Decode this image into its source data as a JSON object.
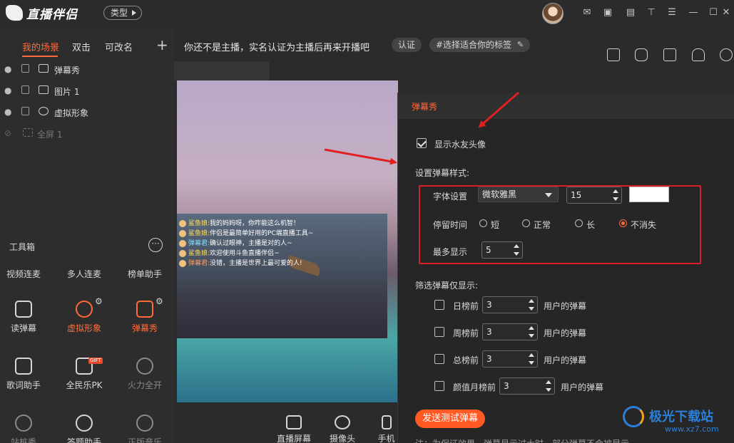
{
  "app": {
    "name": "直播伴侣",
    "type_button": "类型"
  },
  "titlebar_icons": [
    "mail-icon",
    "video-icon",
    "save-icon",
    "shirt-icon",
    "menu-icon",
    "minimize-icon",
    "maximize-icon",
    "close-icon"
  ],
  "scenes": {
    "tabs": [
      {
        "label": "我的场景",
        "active": true
      },
      {
        "label": "双击"
      },
      {
        "label": "可改名"
      }
    ],
    "add_label": "+",
    "layers": [
      {
        "label": "弹幕秀",
        "icon": "danmaku-icon",
        "visible": true
      },
      {
        "label": "图片 1",
        "icon": "image-icon",
        "visible": true
      },
      {
        "label": "虚拟形象",
        "icon": "avatar-icon",
        "visible": true
      },
      {
        "label": "全屏 1",
        "icon": "fullscreen-icon",
        "visible": false
      }
    ]
  },
  "toolbox": {
    "title": "工具箱",
    "more": "···",
    "tools": [
      {
        "label": "视频连麦"
      },
      {
        "label": "多人连麦"
      },
      {
        "label": "榜单助手"
      },
      {
        "label": "读弹幕"
      },
      {
        "label": "虚拟形象",
        "active": true
      },
      {
        "label": "弹幕秀",
        "active": true
      },
      {
        "label": "歌词助手"
      },
      {
        "label": "全民乐PK",
        "badge": "GIFT"
      },
      {
        "label": "火力全开",
        "disabled": true
      },
      {
        "label": "站桩秀",
        "disabled": true
      },
      {
        "label": "答题助手"
      },
      {
        "label": "正版音乐",
        "disabled": true
      }
    ]
  },
  "notice": {
    "text": "你还不是主播，实名认证为主播后再来开播吧",
    "verify_button": "认证",
    "tag_button": "#选择适合你的标签"
  },
  "preview_chat": [
    {
      "name": "鲨鱼娘:",
      "text": "我的妈妈呀，你咋能这么机智！",
      "color": "#ffdd55"
    },
    {
      "name": "鲨鱼娘:",
      "text": "伴侣是最简单好用的PC端直播工具~",
      "color": "#ffdd55"
    },
    {
      "name": "弹幕君:",
      "text": "确认过眼神，主播是对的人~",
      "color": "#7fe3ff"
    },
    {
      "name": "鲨鱼娘:",
      "text": "欢迎使用斗鱼直播伴侣~",
      "color": "#ffdd55"
    },
    {
      "name": "弹幕君:",
      "text": "没错，主播是世界上最可爱的人!",
      "color": "#ff9c5a"
    }
  ],
  "bottom_controls": [
    {
      "label": "直播屏幕"
    },
    {
      "label": "摄像头"
    },
    {
      "label": "手机投"
    }
  ],
  "dialog": {
    "title": "弹幕秀",
    "show_avatar": {
      "label": "显示水友头像",
      "checked": true
    },
    "style_heading": "设置弹幕样式:",
    "font_label": "字体设置",
    "font_value": "微软雅黑",
    "font_size": "15",
    "font_color": "#ffffff",
    "duration_label": "停留时间",
    "duration_options": [
      {
        "label": "短",
        "selected": false
      },
      {
        "label": "正常",
        "selected": false
      },
      {
        "label": "长",
        "selected": false
      },
      {
        "label": "不消失",
        "selected": true
      }
    ],
    "max_label": "最多显示",
    "max_value": "5",
    "filter_heading": "筛选弹幕仅显示:",
    "filters": [
      {
        "label": "日榜前",
        "value": "3",
        "suffix": "用户的弹幕",
        "checked": false
      },
      {
        "label": "周榜前",
        "value": "3",
        "suffix": "用户的弹幕",
        "checked": false
      },
      {
        "label": "总榜前",
        "value": "3",
        "suffix": "用户的弹幕",
        "checked": false
      },
      {
        "label": "颜值月榜前",
        "value": "3",
        "suffix": "用户的弹幕",
        "checked": false
      }
    ],
    "send_test_button": "发送测试弹幕",
    "footnote": "注：为保证效果，弹幕显示过大时，部分弹幕不会被显示"
  },
  "watermark": {
    "name": "极光下载站",
    "url": "www.xz7.com"
  },
  "colors": {
    "accent": "#ff6a3a",
    "highlight_frame": "#d8202a",
    "arrow": "#e02020"
  }
}
